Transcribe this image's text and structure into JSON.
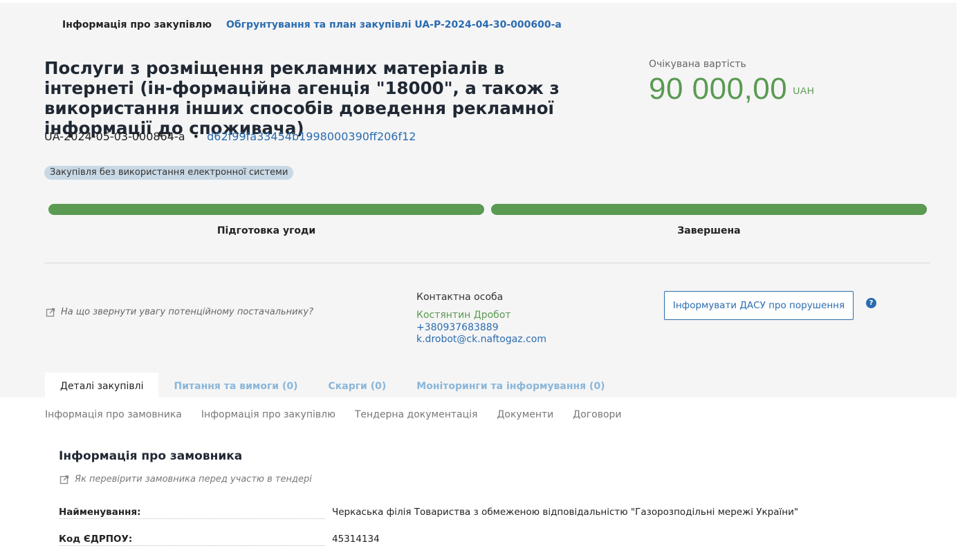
{
  "header": {
    "tab_info": "Інформація про закупівлю",
    "tab_plan": "Обгрунтування та план закупівлі UA-P-2024-04-30-000600-a"
  },
  "tender": {
    "title": "Послуги з розміщення рекламних матеріалів в інтернеті (ін-формаційна агенція \"18000\", а також з використання інших способів доведення рекламної інформації до споживача)",
    "id": "UA-2024-05-03-000864-a",
    "separator": "•",
    "hash": "d62f99fa33454b1998000390ff206f12",
    "badge": "Закупівля без використання електронної системи"
  },
  "price": {
    "label": "Очікувана вартість",
    "value": "90 000,00",
    "currency": "UAH"
  },
  "stages": {
    "stage1": "Підготовка угоди",
    "stage2": "Завершена",
    "progress1": 1.0,
    "progress2": 1.0
  },
  "hint": {
    "supplier": "На що звернути увагу потенційному постачальнику?"
  },
  "contact": {
    "label": "Контактна особа",
    "name": "Костянтин Дробот",
    "phone": "+380937683889",
    "email": "k.drobot@ck.naftogaz.com"
  },
  "actions": {
    "dasu_button": "Інформувати ДАСУ про порушення",
    "help": "?"
  },
  "tabs": [
    {
      "label": "Деталі закупівлі"
    },
    {
      "label": "Питання та вимоги (0)"
    },
    {
      "label": "Скарги (0)"
    },
    {
      "label": "Моніторинги та інформування (0)"
    }
  ],
  "subnav": [
    "Інформація про замовника",
    "Інформація про закупівлю",
    "Тендерна документація",
    "Документи",
    "Договори"
  ],
  "customer": {
    "section_title": "Інформація про замовника",
    "section_hint": "Як перевірити замовника перед участю в тендері",
    "name_label": "Найменування:",
    "name_value": "Черкаська філія Товариства з обмеженою відповідальністю \"Газорозподільні мережі України\"",
    "edrpou_label": "Код ЄДРПОУ:",
    "edrpou_value": "45314134"
  },
  "colors": {
    "accent_green": "#5a9a52",
    "link_blue": "#2b6cb0"
  }
}
